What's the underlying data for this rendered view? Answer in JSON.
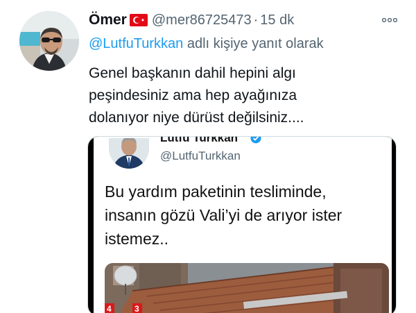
{
  "tweet": {
    "author_name": "Ömer",
    "handle": "@mer86725473",
    "separator": "·",
    "time": "15 dk",
    "reply": {
      "mention": "@LutfuTurkkan",
      "suffix": " adlı kişiye yanıt olarak"
    },
    "text_lines": [
      "Genel başkanın dahil hepini algı",
      "peşindesiniz ama hep ayağınıza",
      "dolanıyor niye dürüst değilsiniz...."
    ]
  },
  "quoted_image": {
    "name": "Lutfu Turkkan",
    "handle": "@LutfuTurkkan",
    "text_lines": [
      "Bu yardım paketinin tesliminde,",
      "insanın gözü Vali’yi de arıyor ister",
      "istemez.."
    ],
    "photo_channel_labels": [
      "4",
      "3"
    ]
  },
  "icons": {
    "flag": "turkey-flag-icon",
    "more": "more-options-icon",
    "verified": "verified-badge-icon"
  },
  "colors": {
    "link": "#1d9bf0",
    "secondary_text": "#536471",
    "flag_red": "#e30a17"
  }
}
